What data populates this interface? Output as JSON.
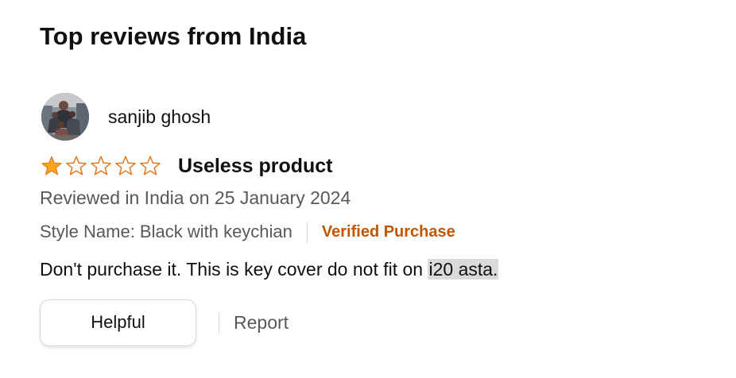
{
  "section": {
    "title": "Top reviews from India"
  },
  "review": {
    "reviewer_name": "sanjib ghosh",
    "rating": 1,
    "rating_max": 5,
    "title": "Useless product",
    "date_text": "Reviewed in India on 25 January 2024",
    "style_text": "Style Name: Black with keychian",
    "verified_label": "Verified Purchase",
    "body_prefix": "Don't purchase it. This is key cover do not fit on ",
    "body_highlight": "i20 asta."
  },
  "actions": {
    "helpful_label": "Helpful",
    "report_label": "Report"
  },
  "colors": {
    "text": "#0f1111",
    "secondary_text": "#565959",
    "star_fill": "#ffa41c",
    "star_outline": "#de7921",
    "verified": "#c45500",
    "selection": "#dadada",
    "divider": "#d5d9d9"
  },
  "icons": {
    "avatar": "reviewer-profile-photo",
    "filled_star": "filled-star-icon",
    "empty_star": "empty-star-icon"
  }
}
